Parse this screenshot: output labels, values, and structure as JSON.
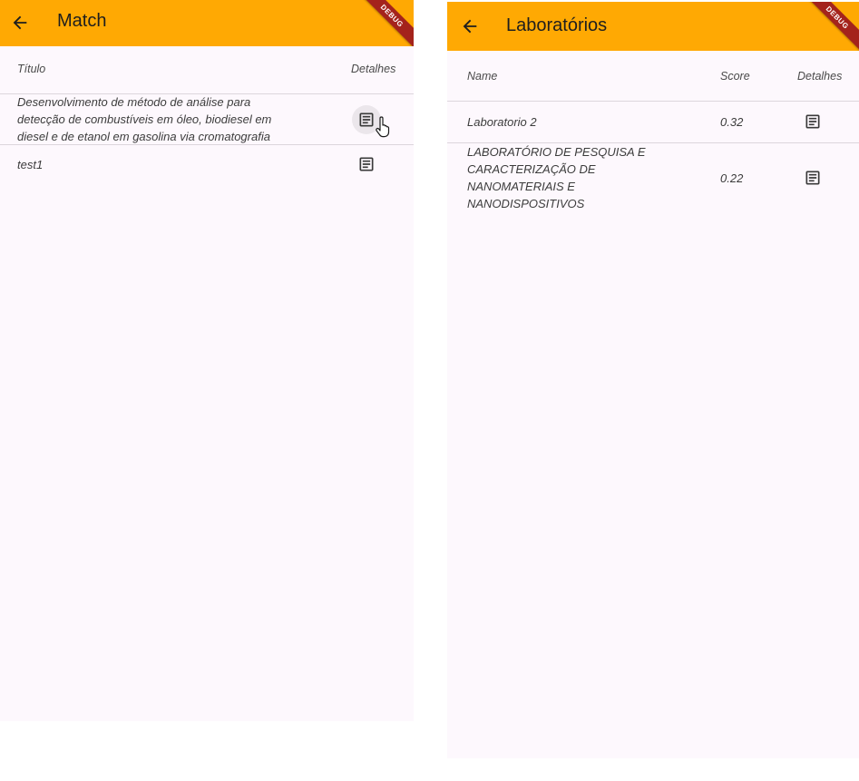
{
  "left_screen": {
    "title": "Match",
    "debug_banner": "DEBUG",
    "table": {
      "headers": {
        "title": "Título",
        "details": "Detalhes"
      },
      "rows": [
        {
          "title": "Desenvolvimento de método de análise para detecção de combustíveis em óleo, biodiesel em diesel e de etanol em gasolina via cromatografia"
        },
        {
          "title": "test1"
        }
      ]
    }
  },
  "right_screen": {
    "title": "Laboratórios",
    "debug_banner": "DEBUG",
    "table": {
      "headers": {
        "name": "Name",
        "score": "Score",
        "details": "Detalhes"
      },
      "rows": [
        {
          "name": "Laboratorio 2",
          "score": "0.32"
        },
        {
          "name": "LABORATÓRIO DE PESQUISA E CARACTERIZAÇÃO DE NANOMATERIAIS E NANODISPOSITIVOS",
          "score": "0.22"
        }
      ]
    }
  },
  "colors": {
    "appbar": "#ffa903",
    "background": "#fdf8fd",
    "debug_banner": "#a4231c"
  },
  "icons": {
    "back": "arrow-back-icon",
    "details": "article-icon",
    "cursor": "hand-pointer-icon"
  }
}
